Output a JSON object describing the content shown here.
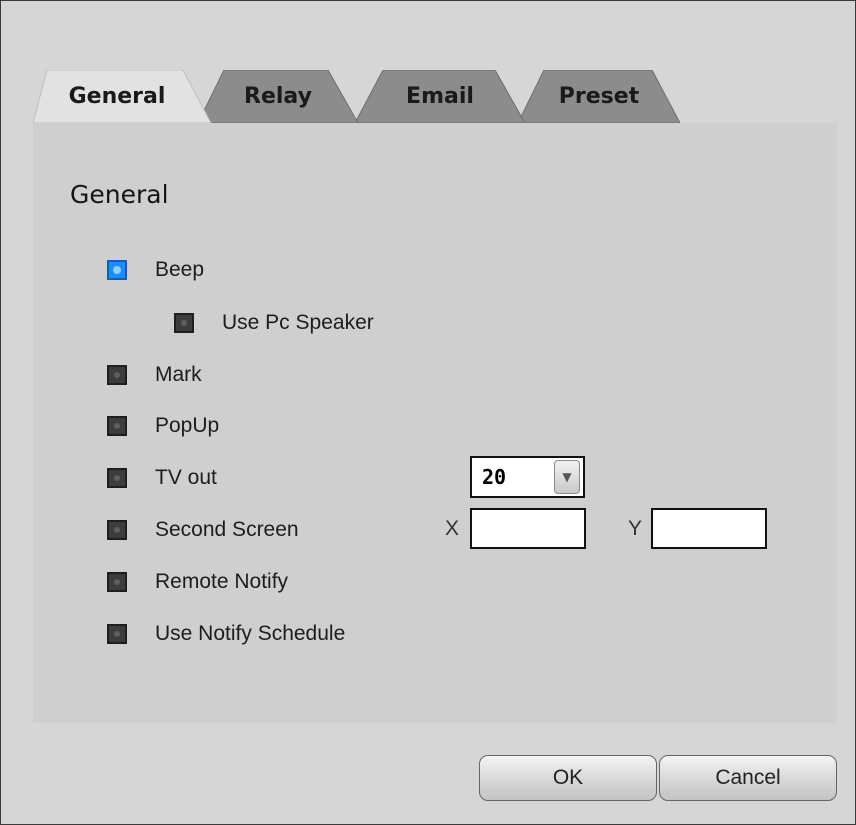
{
  "tabs": {
    "general": "General",
    "relay": "Relay",
    "email": "Email",
    "preset": "Preset",
    "active": "General"
  },
  "section": {
    "title": "General"
  },
  "options": {
    "beep": {
      "label": "Beep",
      "checked": true
    },
    "use_pc_speaker": {
      "label": "Use Pc Speaker",
      "checked": false
    },
    "mark": {
      "label": "Mark",
      "checked": false
    },
    "popup": {
      "label": "PopUp",
      "checked": false
    },
    "tv_out": {
      "label": "TV out",
      "checked": false
    },
    "second_screen": {
      "label": "Second Screen",
      "checked": false
    },
    "remote_notify": {
      "label": "Remote Notify",
      "checked": false
    },
    "use_notify_schedule": {
      "label": "Use Notify Schedule",
      "checked": false
    }
  },
  "tv_out_select": {
    "value": "20"
  },
  "second_screen_coords": {
    "x_label": "X",
    "x_value": "",
    "y_label": "Y",
    "y_value": ""
  },
  "buttons": {
    "ok": "OK",
    "cancel": "Cancel"
  },
  "colors": {
    "checked_accent": "#1e8cff",
    "active_tab": "#e2e2e2",
    "inactive_tab": "#8c8c8c"
  }
}
